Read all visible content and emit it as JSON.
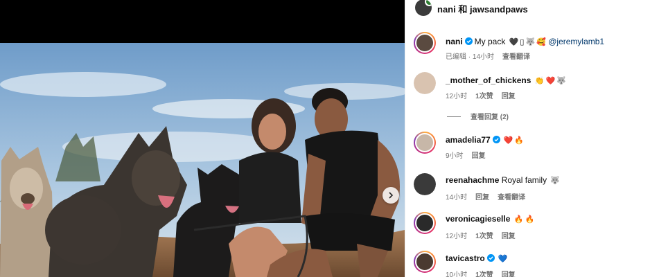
{
  "header": {
    "title": "nani 和 jawsandpaws"
  },
  "caption": {
    "username": "nani",
    "text": "My pack",
    "emojis": [
      "🖤",
      "▯",
      "🐺",
      "🥰"
    ],
    "mention": "@jeremylamb1",
    "meta": {
      "edited": "已编辑",
      "sep": " · ",
      "time": "14小时",
      "translate": "查看翻译"
    }
  },
  "comments": [
    {
      "username": "_mother_of_chickens",
      "text": "",
      "emojis": [
        "👏",
        "❤️",
        "🐺"
      ],
      "time": "12小时",
      "likes": "1次赞",
      "reply": "回复",
      "view_replies": "查看回复 (2)"
    },
    {
      "username": "amadelia77",
      "text": "",
      "verified": true,
      "emojis": [
        "❤️",
        "🔥"
      ],
      "time": "9小时",
      "reply": "回复"
    },
    {
      "username": "reenahachme",
      "text": "Royal family",
      "emojis": [
        "🐺"
      ],
      "time": "14小时",
      "reply": "回复",
      "translate": "查看翻译"
    },
    {
      "username": "veronicagieselle",
      "text": "",
      "emojis": [
        "🔥",
        "🔥"
      ],
      "time": "12小时",
      "likes": "1次赞",
      "reply": "回复"
    },
    {
      "username": "tavicastro",
      "text": "",
      "verified": true,
      "emojis": [
        "💙"
      ],
      "time": "10小时",
      "likes": "1次赞",
      "reply": "回复"
    }
  ],
  "colors": {
    "verified": "#0095f6",
    "mention": "#00376b",
    "meta": "#737373"
  }
}
